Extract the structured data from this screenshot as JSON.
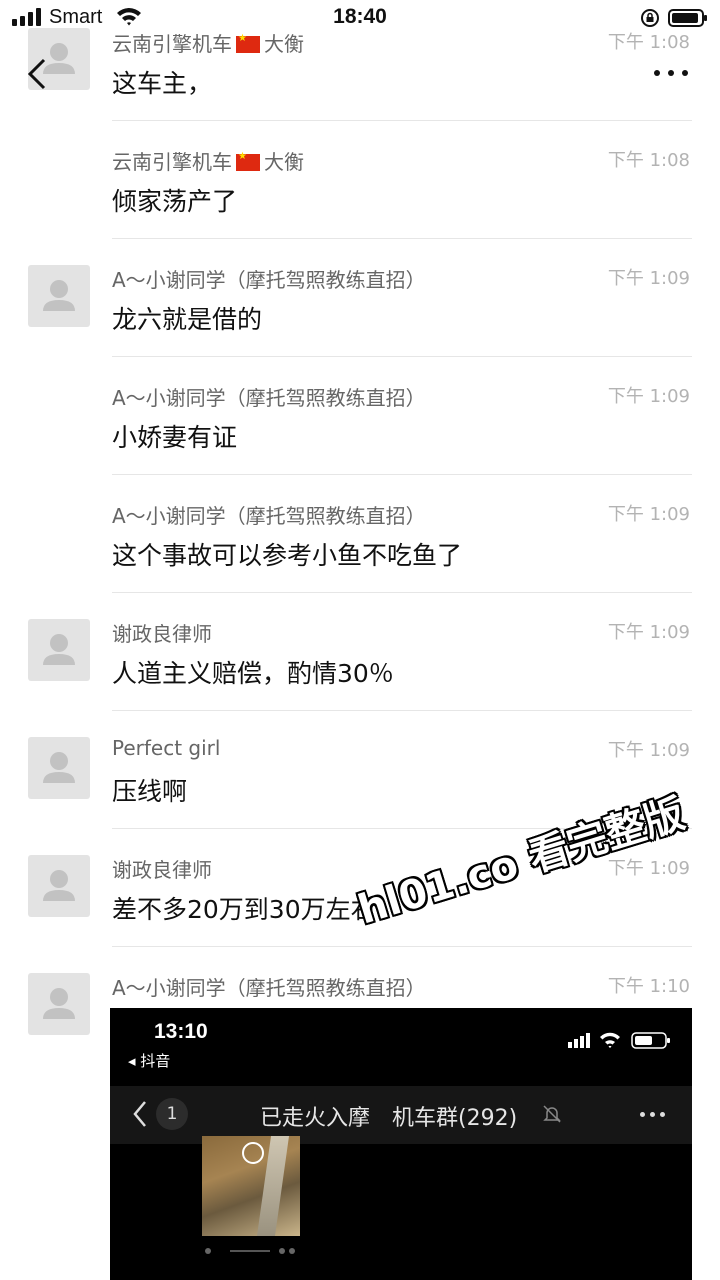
{
  "status_bar": {
    "carrier": "Smart",
    "time": "18:40",
    "signal_icon": "signal-bars-icon",
    "wifi_icon": "wifi-icon",
    "lock_icon": "orientation-lock-icon",
    "battery_icon": "battery-icon",
    "battery_level": 0.85
  },
  "nav": {
    "back_icon": "chevron-left-icon",
    "more_icon": "more-dots-icon"
  },
  "messages": [
    {
      "sender": "云南引擎机车",
      "sender_suffix": "大衡",
      "time": "下午 1:08",
      "text": "这车主，",
      "has_flag": true
    },
    {
      "sender": "云南引擎机车",
      "sender_suffix": "大衡",
      "time": "下午 1:08",
      "text": "倾家荡产了",
      "has_flag": true
    },
    {
      "sender": "A～小谢同学（摩托驾照教练直招）",
      "time": "下午 1:09",
      "text": "龙六就是借的"
    },
    {
      "sender": "A～小谢同学（摩托驾照教练直招）",
      "time": "下午 1:09",
      "text": "小娇妻有证"
    },
    {
      "sender": "A～小谢同学（摩托驾照教练直招）",
      "time": "下午 1:09",
      "text": "这个事故可以参考小鱼不吃鱼了"
    },
    {
      "sender": "谢政良律师",
      "time": "下午 1:09",
      "text": "人道主义赔偿，酌情30％"
    },
    {
      "sender": "Perfect girl",
      "time": "下午 1:09",
      "text": "压线啊"
    },
    {
      "sender": "谢政良律师",
      "time": "下午 1:09",
      "text": "差不多20万到30万左右"
    },
    {
      "sender": "A～小谢同学（摩托驾照教练直招）",
      "time": "下午 1:10",
      "text": ""
    }
  ],
  "embedded_screenshot": {
    "time": "13:10",
    "app_back_label": "◂ 抖音",
    "unread_count": "1",
    "title": "已走火入摩　机车群(292)",
    "mute_icon": "bell-slash-icon",
    "more_icon": "more-dots-icon"
  },
  "watermark": "hl01.co 看完整版",
  "colors": {
    "background": "#ffffff",
    "sender": "#666666",
    "time": "#b3b3b3",
    "divider": "#e6e6e6",
    "avatar_bg": "#e3e3e3"
  }
}
